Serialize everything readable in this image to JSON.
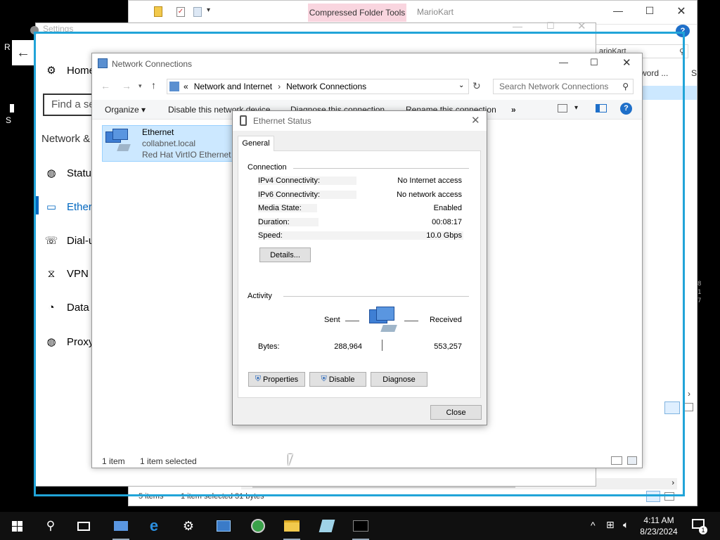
{
  "explorer": {
    "ribbon_tab": "Compressed Folder Tools",
    "title": "MarioKart",
    "search_fragment": "arioKart",
    "col_header": "ssword ...",
    "status_items": "5 items",
    "status_selected": "1 item selected  31 bytes"
  },
  "settings": {
    "title": "Settings",
    "home": "Home",
    "find": "Find a se",
    "section": "Network &",
    "items": [
      {
        "label": "Status",
        "icon": "globe-icon"
      },
      {
        "label": "Ether",
        "icon": "monitor-icon"
      },
      {
        "label": "Dial-u",
        "icon": "phone-icon"
      },
      {
        "label": "VPN",
        "icon": "vpn-icon"
      },
      {
        "label": "Data",
        "icon": "pie-icon"
      },
      {
        "label": "Proxy",
        "icon": "globe-icon"
      }
    ]
  },
  "netconn": {
    "title": "Network Connections",
    "breadcrumb_prefix": "«",
    "crumb1": "Network and Internet",
    "crumb2": "Network Connections",
    "search_placeholder": "Search Network Connections",
    "cmd": {
      "organize": "Organize ▾",
      "disable": "Disable this network device",
      "diagnose": "Diagnose this connection",
      "rename": "Rename this connection",
      "more": "»"
    },
    "adapter": {
      "name": "Ethernet",
      "domain": "collabnet.local",
      "driver": "Red Hat VirtIO Ethernet A"
    },
    "status_count": "1 item",
    "status_selected": "1 item selected"
  },
  "eth_status": {
    "title": "Ethernet Status",
    "tab": "General",
    "connection_heading": "Connection",
    "rows": [
      {
        "label": "IPv4 Connectivity:",
        "value": "No Internet access"
      },
      {
        "label": "IPv6 Connectivity:",
        "value": "No network access"
      },
      {
        "label": "Media State:",
        "value": "Enabled"
      },
      {
        "label": "Duration:",
        "value": "00:08:17"
      },
      {
        "label": "Speed:",
        "value": "10.0 Gbps"
      }
    ],
    "details_button": "Details...",
    "activity_heading": "Activity",
    "sent_label": "Sent",
    "received_label": "Received",
    "bytes_label": "Bytes:",
    "bytes_sent": "288,964",
    "bytes_received": "553,257",
    "properties_button": "Properties",
    "disable_button": "Disable",
    "diagnose_button": "Diagnose",
    "close_button": "Close"
  },
  "taskbar": {
    "time": "4:11 AM",
    "date": "8/23/2024",
    "notif_count": "1"
  },
  "desktop": {
    "left_r": "R",
    "left_s": "S"
  },
  "colors": {
    "highlight": "#21a4d8",
    "selection": "#cce8ff",
    "compressed_tab": "#f9d5df"
  }
}
